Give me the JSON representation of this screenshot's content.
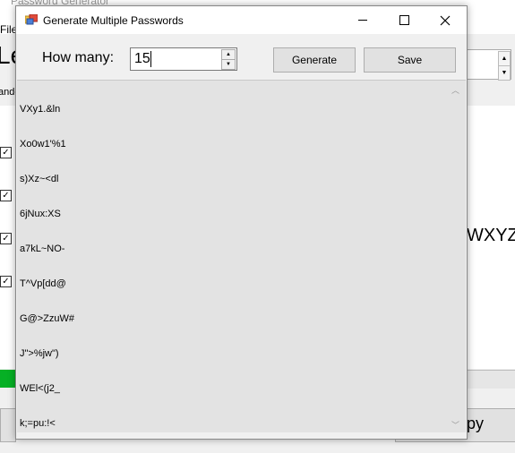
{
  "background": {
    "window_title": "Password Generator",
    "menu_file": "File",
    "big_label": "Le",
    "cut_label": "ando",
    "checkbox_mark": "✓",
    "visible_charset": "WXYZ",
    "copy_button_fragment": "py",
    "accent_green": "#06b025"
  },
  "dialog": {
    "title": "Generate Multiple Passwords",
    "how_many_label": "How many:",
    "how_many_value": "15",
    "generate_label": "Generate",
    "save_label": "Save",
    "passwords": [
      "VXy1.&ln",
      "Xo0w1'%1",
      "s)Xz~<dl",
      "6jNux:XS",
      "a7kL~NO-",
      "T^Vp[dd@",
      "G@>ZzuW#",
      "J\">%jw\")",
      "WEl<(j2_",
      "k;=pu:!<"
    ]
  },
  "icons": {
    "minimize": "minimize-icon",
    "maximize": "maximize-icon",
    "close": "close-icon",
    "scroll_up": "chevron-up-icon",
    "scroll_down": "chevron-down-icon"
  }
}
